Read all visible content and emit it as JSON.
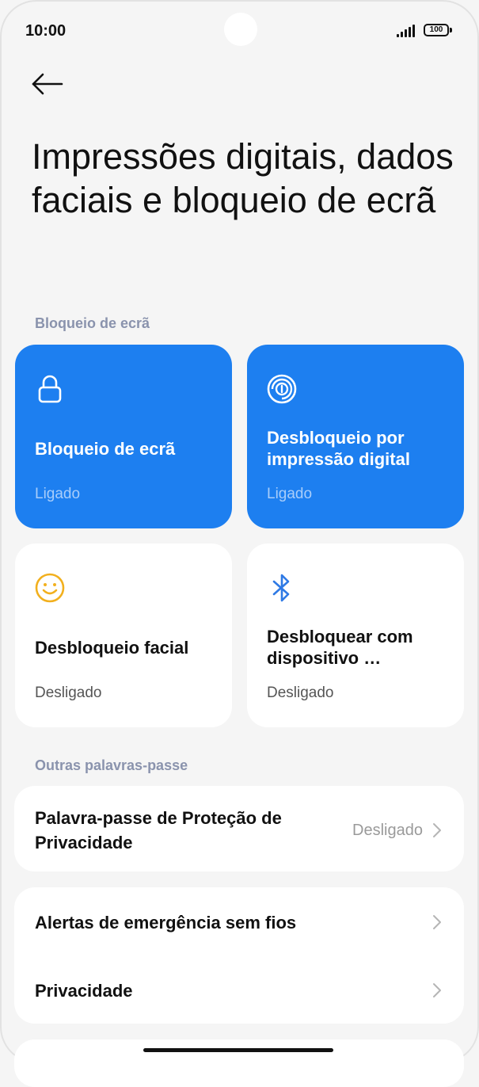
{
  "status_bar": {
    "time": "10:00",
    "battery": "100"
  },
  "header": {
    "back_icon": "arrow-left-icon",
    "title": "Impressões digitais, dados faciais e bloqueio de ecrã"
  },
  "sections": {
    "screen_lock_header": "Bloqueio de ecrã",
    "other_passwords_header": "Outras palavras-passe"
  },
  "tiles": [
    {
      "title": "Bloqueio de ecrã",
      "status": "Ligado",
      "icon": "lock-icon",
      "active": true
    },
    {
      "title": "Desbloqueio por impressão digital",
      "status": "Ligado",
      "icon": "fingerprint-icon",
      "active": true
    },
    {
      "title": "Desbloqueio facial",
      "status": "Desligado",
      "icon": "smiley-face-icon",
      "active": false
    },
    {
      "title": "Desbloquear com dispositivo …",
      "status": "Desligado",
      "icon": "bluetooth-icon",
      "active": false
    }
  ],
  "list": {
    "privacy_password": {
      "label": "Palavra-passe de Proteção de Privacidade",
      "value": "Desligado"
    },
    "emergency_alerts": {
      "label": "Alertas de emergência sem fios"
    },
    "privacy": {
      "label": "Privacidade"
    }
  },
  "colors": {
    "accent": "#1d7ff0",
    "accent_status": "#a8cdfa",
    "section_header": "#8a93ad",
    "background": "#f5f5f5",
    "smiley": "#f2b01e",
    "bluetooth": "#2f7ae5"
  }
}
